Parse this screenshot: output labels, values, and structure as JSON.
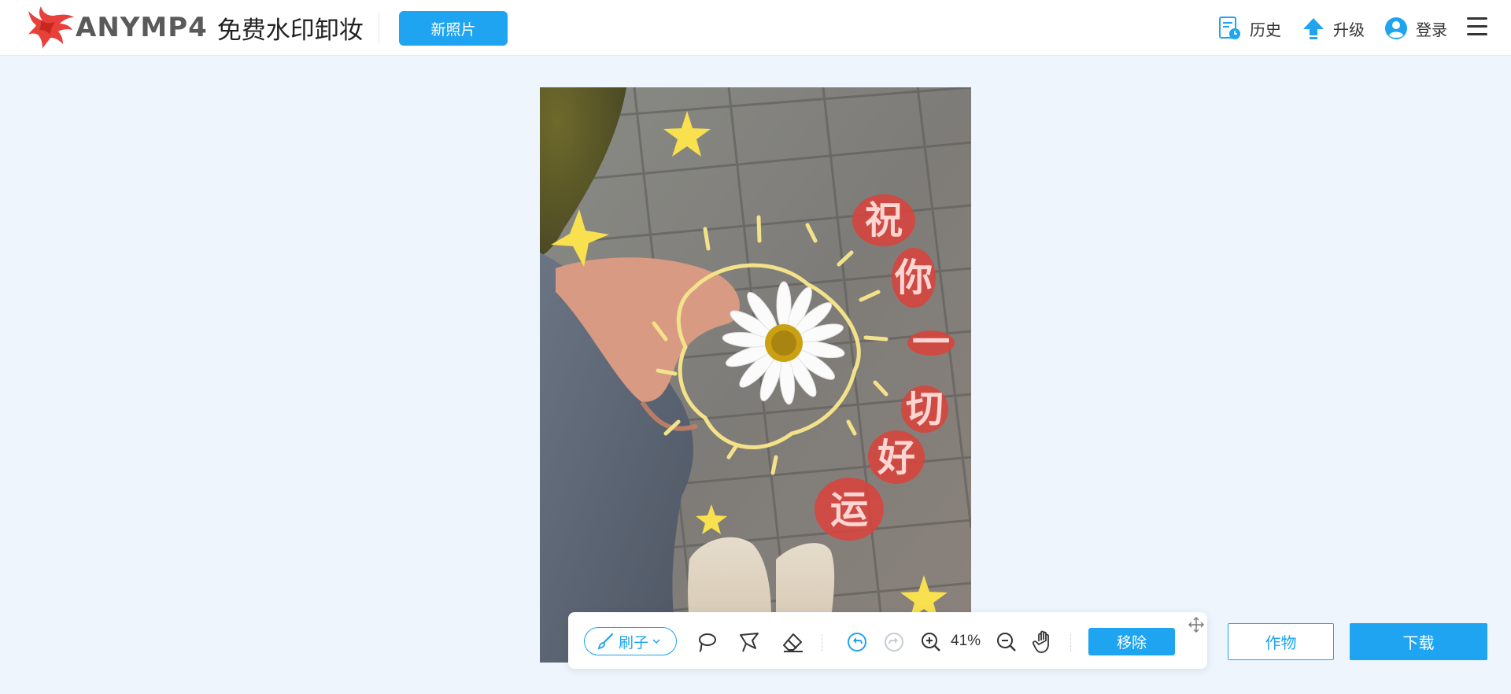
{
  "header": {
    "logo_brand": "ANYMP4",
    "logo_product": "免费水印卸妆",
    "new_photo_button": "新照片",
    "nav": {
      "history": "历史",
      "upgrade": "升级",
      "login": "登录"
    }
  },
  "photo": {
    "overlay_text": [
      "祝",
      "你",
      "一",
      "切",
      "好",
      "运"
    ]
  },
  "toolbar": {
    "brush_label": "刷子",
    "zoom": "41%",
    "remove_button": "移除"
  },
  "actions": {
    "crop_button": "作物",
    "download_button": "下载"
  },
  "colors": {
    "accent": "#1ea4f0",
    "background": "#eef5fd",
    "logo_red": "#e8403a"
  },
  "icons": {
    "history": "history-icon",
    "upgrade": "upgrade-arrow-icon",
    "login": "user-avatar-icon",
    "menu": "hamburger-menu-icon",
    "brush": "brush-icon",
    "lasso": "lasso-icon",
    "polygon_lasso": "polygon-lasso-icon",
    "eraser": "eraser-icon",
    "undo": "undo-icon",
    "redo": "redo-icon",
    "zoom_in": "zoom-in-icon",
    "zoom_out": "zoom-out-icon",
    "hand": "hand-pan-icon",
    "move": "move-icon"
  }
}
